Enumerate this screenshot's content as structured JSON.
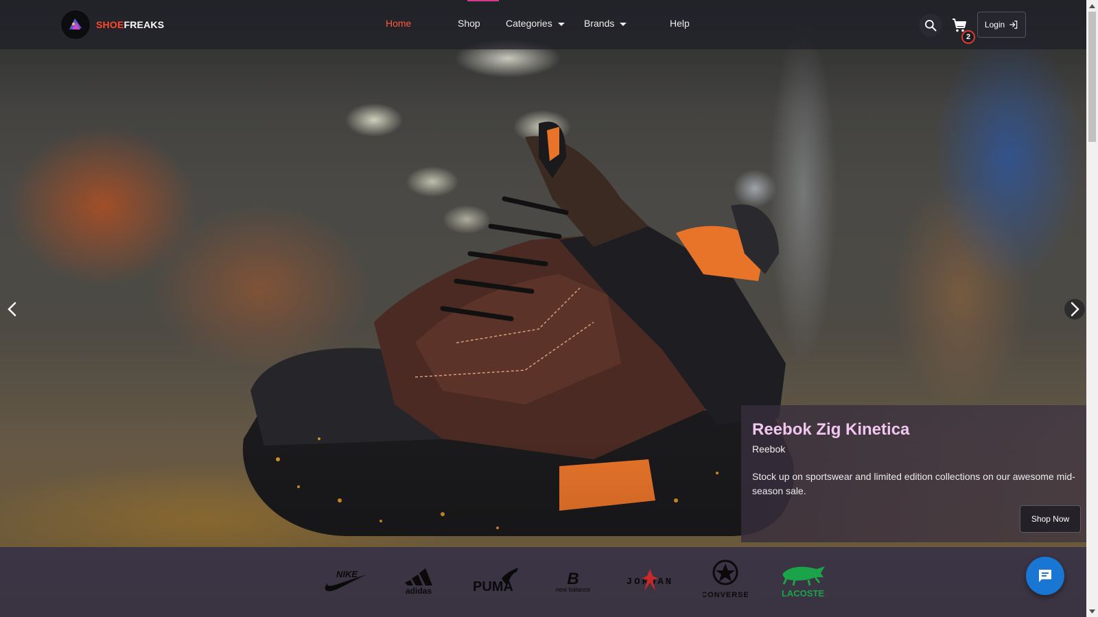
{
  "brand": {
    "part1": "SHOE",
    "part2": "FREAKS"
  },
  "nav": {
    "home": "Home",
    "shop": "Shop",
    "categories": "Categories",
    "brands": "Brands",
    "help": "Help"
  },
  "header": {
    "cart_count": "2",
    "login_label": "Login"
  },
  "slide": {
    "title": "Reebok Zig Kinetica",
    "brand": "Reebok",
    "description": "Stock up on sportswear and limited edition collections on our awesome mid-season sale.",
    "cta": "Shop Now"
  },
  "brand_logos": [
    "NIKE",
    "adidas",
    "PUMA",
    "new balance",
    "JORDAN",
    "CONVERSE",
    "LACOSTE"
  ],
  "colors": {
    "accent": "#ff5a3c",
    "caption_title": "#f1c6f0",
    "chat_fab": "#1976d2",
    "badge_border": "#e0392e"
  },
  "icons": [
    "search-icon",
    "cart-icon",
    "login-icon",
    "chevron-left-icon",
    "chevron-right-icon",
    "chat-icon"
  ]
}
